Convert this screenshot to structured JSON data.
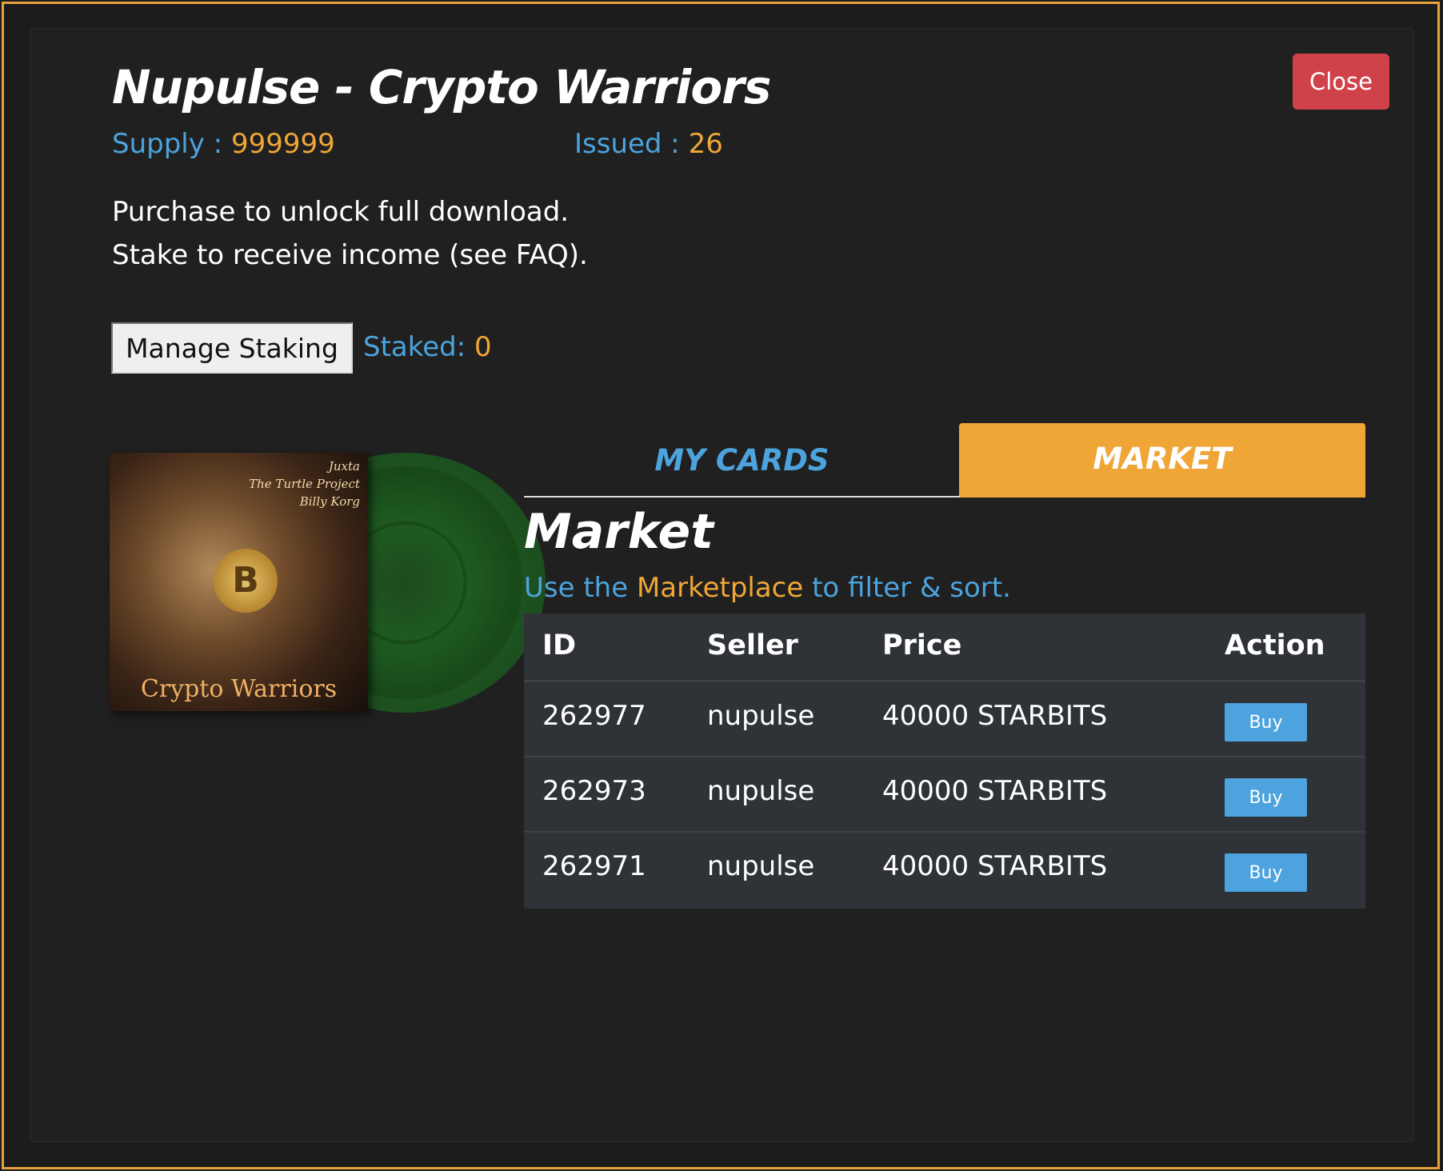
{
  "modal": {
    "title": "Nupulse - Crypto Warriors",
    "close_label": "Close",
    "supply_label": "Supply : ",
    "supply_value": "999999",
    "issued_label": "Issued : ",
    "issued_value": "26",
    "description_line1": "Purchase to unlock full download.",
    "description_line2": "Stake to receive income (see FAQ).",
    "manage_staking_label": "Manage Staking",
    "staked_label": "Staked: ",
    "staked_value": "0"
  },
  "album": {
    "credit1": "Juxta",
    "credit2": "The Turtle Project",
    "credit3": "Billy Korg",
    "cover_title": "Crypto Warriors",
    "coin_symbol": "B"
  },
  "tabs": [
    {
      "label": "MY CARDS",
      "active": false
    },
    {
      "label": "MARKET",
      "active": true
    }
  ],
  "market": {
    "heading": "Market",
    "hint_pre": "Use the ",
    "hint_link": "Marketplace",
    "hint_post": " to filter & sort.",
    "columns": [
      "ID",
      "Seller",
      "Price",
      "Action"
    ],
    "rows": [
      {
        "id": "262977",
        "seller": "nupulse",
        "price": "40000 STARBITS",
        "action": "Buy"
      },
      {
        "id": "262973",
        "seller": "nupulse",
        "price": "40000 STARBITS",
        "action": "Buy"
      },
      {
        "id": "262971",
        "seller": "nupulse",
        "price": "40000 STARBITS",
        "action": "Buy"
      }
    ]
  },
  "colors": {
    "accent_orange": "#f0a637",
    "accent_blue": "#4ca3dd",
    "close_red": "#d0424a",
    "background": "#202020"
  }
}
